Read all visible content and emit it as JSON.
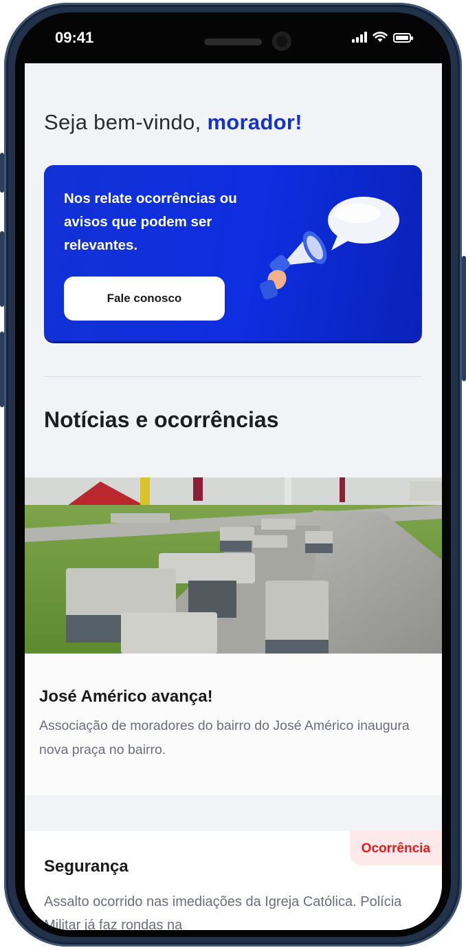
{
  "status_bar": {
    "time": "09:41"
  },
  "greeting": {
    "prefix": "Seja bem-vindo,",
    "name": "morador!"
  },
  "banner": {
    "text": "Nos relate ocorrências ou avisos que podem ser relevantes.",
    "button_label": "Fale conosco",
    "illustration": "megaphone-speech-bubble",
    "color": "#1232d6"
  },
  "section": {
    "title": "Notícias e ocorrências"
  },
  "news": [
    {
      "title": "José Américo avança!",
      "description": "Associação de moradores do bairro do José Américo inaugura nova praça no bairro.",
      "image": "park-square-photo"
    }
  ],
  "occurrences": [
    {
      "badge": "Ocorrência",
      "title": "Segurança",
      "description": "Assalto ocorrido nas imediações da Igreja Católica. Polícia Militar já faz rondas na",
      "badge_color": "#e01c1c"
    }
  ]
}
